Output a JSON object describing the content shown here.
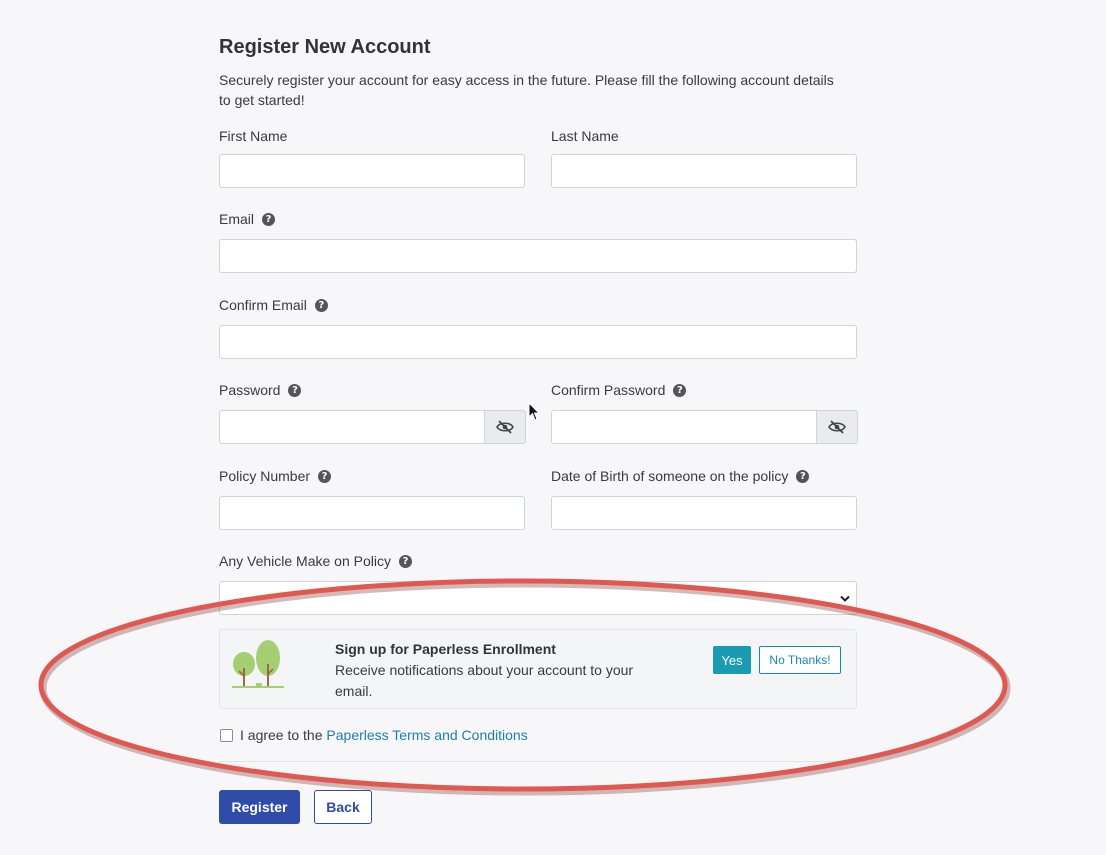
{
  "page": {
    "title": "Register New Account",
    "subtitle": "Securely register your account for easy access in the future. Please fill the following account details to get started!"
  },
  "form": {
    "first_name": {
      "label": "First Name",
      "value": ""
    },
    "last_name": {
      "label": "Last Name",
      "value": ""
    },
    "email": {
      "label": "Email",
      "value": ""
    },
    "confirm_email": {
      "label": "Confirm Email",
      "value": ""
    },
    "password": {
      "label": "Password",
      "value": ""
    },
    "confirm_password": {
      "label": "Confirm Password",
      "value": ""
    },
    "policy_number": {
      "label": "Policy Number",
      "value": ""
    },
    "dob": {
      "label": "Date of Birth of someone on the policy",
      "value": ""
    },
    "vehicle_make": {
      "label": "Any Vehicle Make on Policy",
      "selected": ""
    }
  },
  "paperless": {
    "title": "Sign up for Paperless Enrollment",
    "description": "Receive notifications about your account to your email.",
    "yes_label": "Yes",
    "no_label": "No Thanks!"
  },
  "agree": {
    "prefix": "I agree to the",
    "link": "Paperless Terms and Conditions",
    "checked": false
  },
  "actions": {
    "register_label": "Register",
    "back_label": "Back"
  },
  "colors": {
    "primary": "#2f4ca8",
    "teal": "#1b9bb3",
    "link": "#1b7fae",
    "annotation": "#e0584f"
  }
}
